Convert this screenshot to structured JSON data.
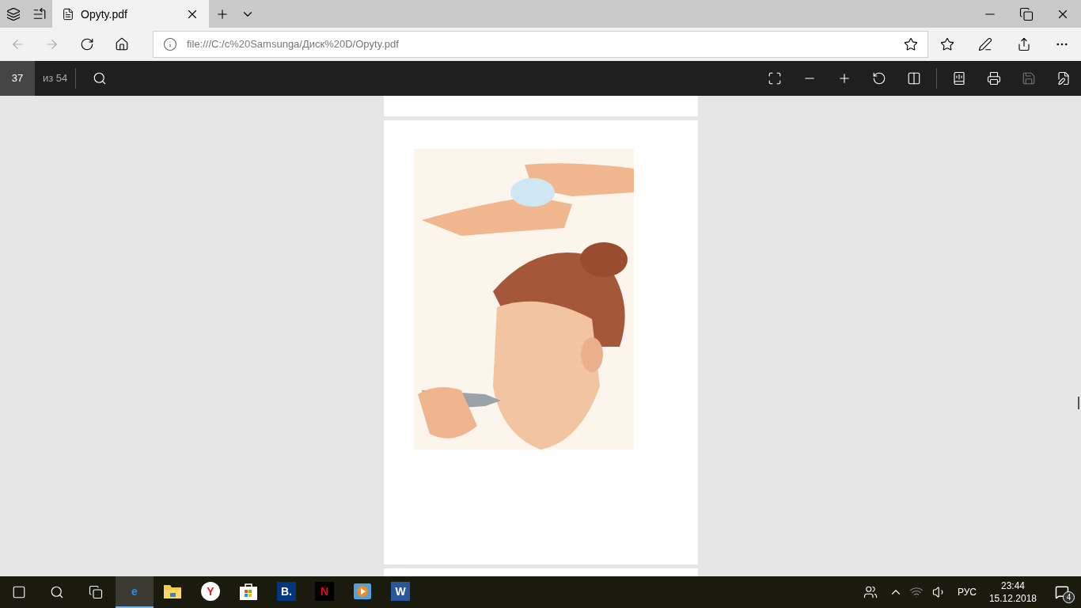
{
  "tab": {
    "title": "Opyty.pdf",
    "selected": true
  },
  "address_bar": {
    "url": "file:///C:/c%20Samsunga/Диск%20D/Opyty.pdf"
  },
  "pdf_toolbar": {
    "page": "37",
    "page_count": "из 54"
  },
  "document": {
    "pages": [
      {
        "kind": "partial"
      },
      {
        "kind": "picture"
      },
      {
        "kind": "partial"
      }
    ]
  },
  "taskbar": {
    "apps": [
      {
        "kind": "edge",
        "glyph": "e",
        "selected": true
      },
      {
        "kind": "folder",
        "selected": false
      },
      {
        "kind": "yandex",
        "glyph": "Y",
        "selected": false
      },
      {
        "kind": "store",
        "selected": false
      },
      {
        "kind": "booking",
        "glyph": "B.",
        "selected": false
      },
      {
        "kind": "netflix",
        "glyph": "N",
        "selected": false
      },
      {
        "kind": "player",
        "selected": false
      },
      {
        "kind": "word",
        "glyph": "W",
        "selected": false
      }
    ],
    "language": "РУС",
    "time": "23:44",
    "date": "15.12.2018",
    "notifications": "4"
  }
}
